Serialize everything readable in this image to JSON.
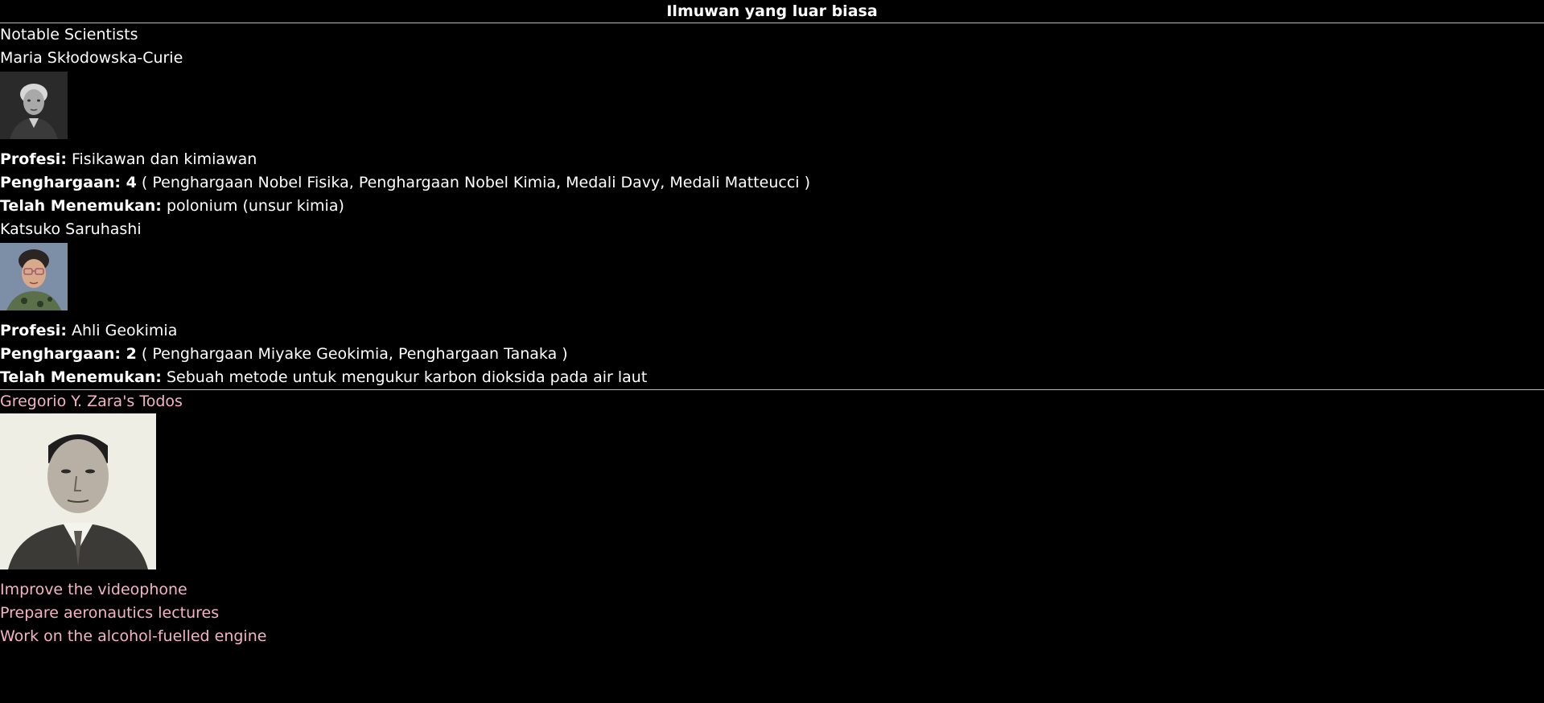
{
  "header": {
    "title": "Ilmuwan yang luar biasa"
  },
  "section": {
    "title": "Notable Scientists",
    "scientists": [
      {
        "name": "Maria Skłodowska-Curie",
        "profession_label": "Profesi:",
        "profession": "Fisikawan dan kimiawan",
        "awards_label": "Penghargaan: 4",
        "awards": "( Penghargaan Nobel Fisika, Penghargaan Nobel Kimia, Medali Davy, Medali Matteucci )",
        "discovered_label": "Telah Menemukan:",
        "discovered": "polonium (unsur kimia)"
      },
      {
        "name": "Katsuko Saruhashi",
        "profession_label": "Profesi:",
        "profession": "Ahli Geokimia",
        "awards_label": "Penghargaan: 2",
        "awards": "( Penghargaan Miyake Geokimia, Penghargaan Tanaka )",
        "discovered_label": "Telah Menemukan:",
        "discovered": "Sebuah metode untuk mengukur karbon dioksida pada air laut"
      }
    ]
  },
  "todos": {
    "title": "Gregorio Y. Zara's Todos",
    "items": [
      "Improve the videophone",
      "Prepare aeronautics lectures",
      "Work on the alcohol-fuelled engine"
    ]
  },
  "colors": {
    "background": "#000000",
    "text": "#ffffff",
    "accent": "#f5b4c4",
    "divider": "#bbbbbb"
  }
}
